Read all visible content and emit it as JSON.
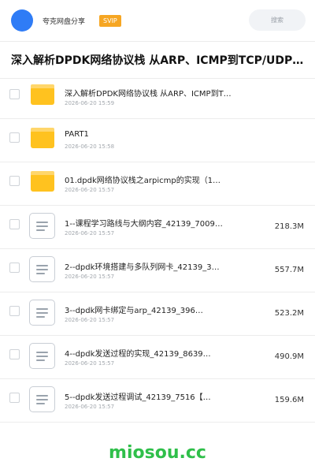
{
  "header": {
    "user_name": "夸克网盘分享",
    "badge": "SVIP",
    "search_placeholder": "搜索"
  },
  "share": {
    "title": "深入解析DPDK网络协议栈 从ARP、ICMP到TCP/UDP的…"
  },
  "files": [
    {
      "type": "folder",
      "name": "深入解析DPDK网络协议栈 从ARP、ICMP到T…",
      "date": "2026-06-20 15:59",
      "size": ""
    },
    {
      "type": "folder",
      "name": "PART1",
      "date": "2026-06-20 15:58",
      "size": ""
    },
    {
      "type": "folder",
      "name": "01.dpdk网络协议栈之arpicmp的实现（1…",
      "date": "2026-06-20 15:57",
      "size": ""
    },
    {
      "type": "doc",
      "name": "1--课程学习路线与大纲内容_42139_7009…",
      "date": "2026-06-20 15:57",
      "size": "218.3M"
    },
    {
      "type": "doc",
      "name": "2--dpdk环境搭建与多队列网卡_42139_3…",
      "date": "2026-06-20 15:57",
      "size": "557.7M"
    },
    {
      "type": "doc",
      "name": "3--dpdk网卡绑定与arp_42139_396…",
      "date": "2026-06-20 15:57",
      "size": "523.2M"
    },
    {
      "type": "doc",
      "name": "4--dpdk发送过程的实现_42139_8639…",
      "date": "2026-06-20 15:57",
      "size": "490.9M"
    },
    {
      "type": "doc",
      "name": "5--dpdk发送过程调试_42139_7516【…",
      "date": "2026-06-20 15:57",
      "size": "159.6M"
    }
  ],
  "watermark": "miosou.cc",
  "colors": {
    "avatar": "#2f7cf6",
    "svip": "#f6a623",
    "folder": "#ffc21f",
    "watermark": "#2fbf4a"
  }
}
